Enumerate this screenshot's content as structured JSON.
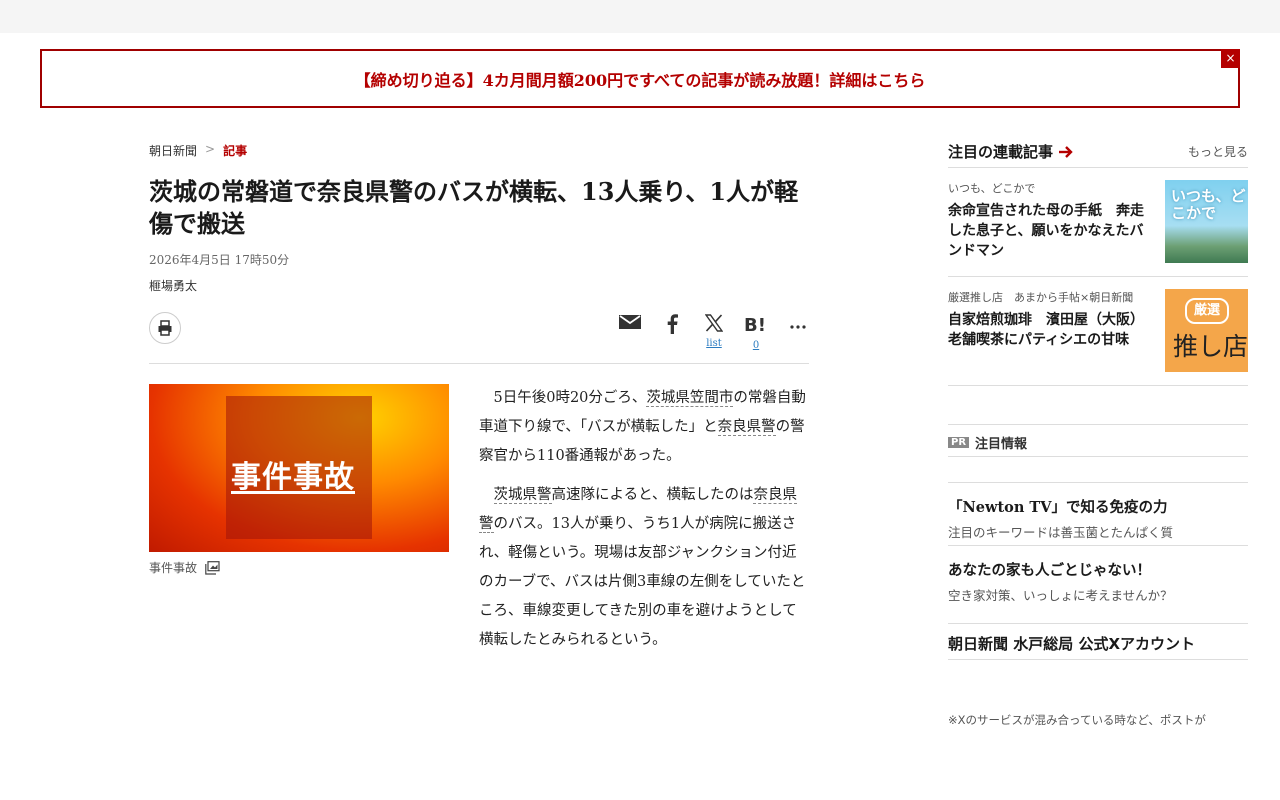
{
  "banner": {
    "text": "【締め切り迫る】4カ月間月額200円ですべての記事が読み放題！詳細はこちら",
    "close": "×"
  },
  "breadcrumb": {
    "home": "朝日新聞",
    "sep": ">",
    "current": "記事"
  },
  "article": {
    "title": "茨城の常磐道で奈良県警のバスが横転、13人乗り、1人が軽傷で搬送",
    "date": "2026年4月5日 17時50分",
    "author": "榧場勇太",
    "share": {
      "x_count": "list",
      "hatena_count": "0"
    },
    "photo_label": "事件事故",
    "caption": "事件事故",
    "p1": {
      "a": "5日午後0時20分ごろ、",
      "link1": "茨城県笠間市",
      "b": "の常磐自動車道下り線で、「バスが横転した」と",
      "link2": "奈良県警",
      "c": "の警察官から110番通報があった。"
    },
    "p2": {
      "link1": "茨城県警",
      "a": "高速隊によると、横転したのは",
      "link2": "奈良県警",
      "b": "のバス。13人が乗り、うち1人が病院に搬送され、軽傷という。現場は友部ジャンクション付近のカーブで、バスは片側3車線の左側をしていたところ、車線変更してきた別の車を避けようとして横転したとみられるという。"
    }
  },
  "sidebar": {
    "title": "注目の連載記事",
    "more": "もっと見る",
    "cards": [
      {
        "series": "いつも、どこかで",
        "headline": "余命宣告された母の手紙　奔走した息子と、願いをかなえたバンドマン",
        "thumb": "いつも、どこかで"
      },
      {
        "series": "厳選推し店　あまから手帖×朝日新聞",
        "headline": "自家焙煎珈琲　濱田屋（大阪）　老舗喫茶にパティシエの甘味",
        "thumb_a": "厳選",
        "thumb_b": "推し店"
      }
    ],
    "pr_tag": "PR",
    "pr_label": "注目情報",
    "ads": [
      {
        "title": "「Newton TV」で知る免疫の力",
        "sub": "注目のキーワードは善玉菌とたんぱく質"
      },
      {
        "title": "あなたの家も人ごとじゃない！",
        "sub": "空き家対策、いっしょに考えませんか？"
      }
    ],
    "x_account": "朝日新聞 水戸総局 公式Xアカウント",
    "x_note": "※Xのサービスが混み合っている時など、ポストが"
  }
}
